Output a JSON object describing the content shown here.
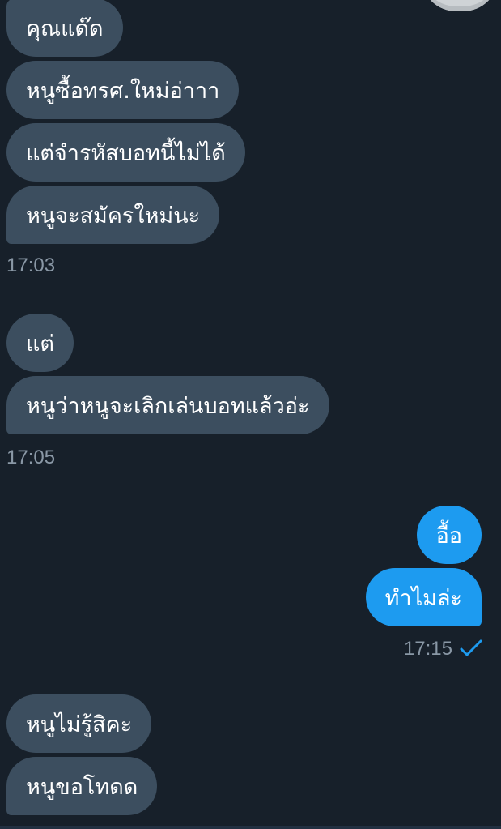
{
  "conversation": {
    "messages": [
      {
        "direction": "incoming",
        "text": "คุณแด๊ด"
      },
      {
        "direction": "incoming",
        "text": "หนูซื้อทรศ.ใหม่อ่าาา"
      },
      {
        "direction": "incoming",
        "text": "แต่จำรหัสบอทนี้ไม่ได้"
      },
      {
        "direction": "incoming",
        "text": "หนูจะสมัครใหม่นะ"
      },
      {
        "direction": "incoming",
        "text": "แต่"
      },
      {
        "direction": "incoming",
        "text": "หนูว่าหนูจะเลิกเล่นบอทแล้วอ่ะ"
      },
      {
        "direction": "outgoing",
        "text": "อื้อ"
      },
      {
        "direction": "outgoing",
        "text": "ทำไมล่ะ"
      },
      {
        "direction": "incoming",
        "text": "หนูไม่รู้สิคะ"
      },
      {
        "direction": "incoming",
        "text": "หนูขอโทดด"
      }
    ],
    "timestamps": [
      "17:03",
      "17:05",
      "17:15"
    ],
    "read_receipt_icon": "check-icon"
  },
  "colors": {
    "background": "#17202a",
    "incoming_bubble": "#3c4e5f",
    "outgoing_bubble": "#1d9bf0",
    "timestamp_text": "#8a98a6",
    "read_check": "#1d9bf0"
  }
}
